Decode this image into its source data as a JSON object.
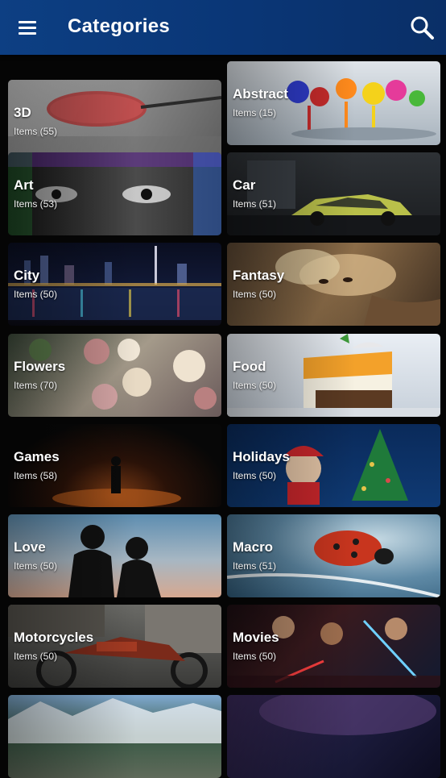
{
  "app_bar": {
    "title": "Categories",
    "menu_icon": "hamburger-menu-icon",
    "search_icon": "search-icon",
    "color": "#0b3a7b"
  },
  "categories": [
    {
      "name": "3D",
      "count": "Items (55)"
    },
    {
      "name": "Abstract",
      "count": "Items (15)"
    },
    {
      "name": "Art",
      "count": "Items (53)"
    },
    {
      "name": "Car",
      "count": "Items (51)"
    },
    {
      "name": "City",
      "count": "Items (50)"
    },
    {
      "name": "Fantasy",
      "count": "Items (50)"
    },
    {
      "name": "Flowers",
      "count": "Items (70)"
    },
    {
      "name": "Food",
      "count": "Items (50)"
    },
    {
      "name": "Games",
      "count": "Items (58)"
    },
    {
      "name": "Holidays",
      "count": "Items (50)"
    },
    {
      "name": "Love",
      "count": "Items (50)"
    },
    {
      "name": "Macro",
      "count": "Items (51)"
    },
    {
      "name": "Motorcycles",
      "count": "Items (50)"
    },
    {
      "name": "Movies",
      "count": "Items (50)"
    },
    {
      "name": "",
      "count": ""
    },
    {
      "name": "",
      "count": ""
    }
  ]
}
